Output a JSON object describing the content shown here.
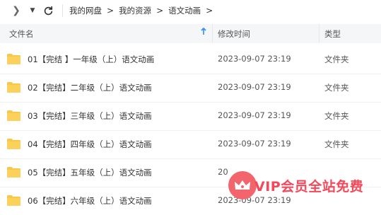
{
  "toolbar": {
    "forward_icon": "chevron-right-icon",
    "dropdown_icon": "caret-down-icon",
    "refresh_icon": "refresh-icon"
  },
  "breadcrumb": [
    "我的网盘",
    "我的资源",
    "语文动画"
  ],
  "columns": {
    "name": "文件名",
    "modified": "修改时间",
    "type": "类型",
    "sort_icon": "sort-up-arrow-icon"
  },
  "files": [
    {
      "name": "01【完结 】一年级（上）语文动画",
      "modified": "2023-09-07 23:19",
      "type": "文件夹"
    },
    {
      "name": "02【完结】二年级（上）语文动画",
      "modified": "2023-09-07 23:19",
      "type": "文件夹"
    },
    {
      "name": "03【完结】三年级（上）语文动画",
      "modified": "2023-09-07 23:19",
      "type": "文件夹"
    },
    {
      "name": "04【完结】四年级（上）语文动画",
      "modified": "2023-09-07 23:19",
      "type": "文件夹"
    },
    {
      "name": "05【完结】五年级（上）语文动画",
      "modified": "20",
      "type": ""
    },
    {
      "name": "06【完结】六年级（上）语文动画",
      "modified": "2023-09-07 23:19",
      "type": ""
    }
  ],
  "watermark": {
    "text": "VIP会员全站免费",
    "color": "#f5485a"
  },
  "colors": {
    "folder": "#f7c94b",
    "accent": "#2e8dfb"
  }
}
